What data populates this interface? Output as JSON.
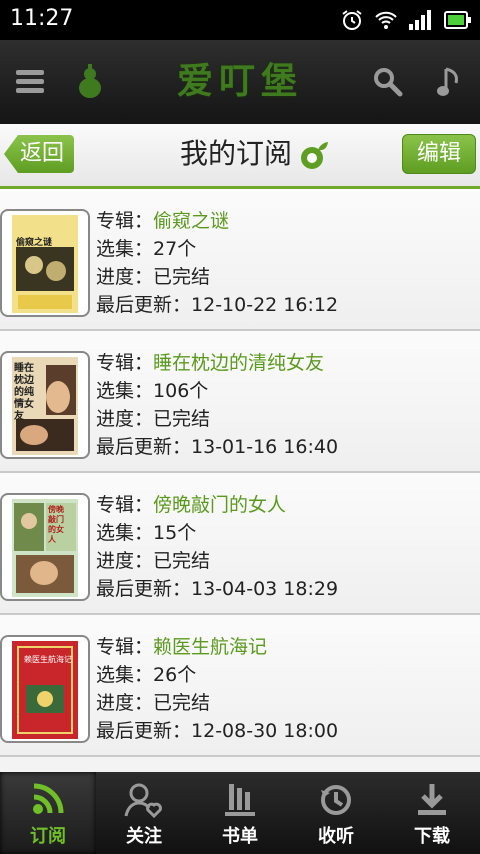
{
  "status_bar": {
    "time": "11:27"
  },
  "app_bar": {
    "logo_text": "爱叮堡"
  },
  "title_bar": {
    "back_label": "返回",
    "title": "我的订阅",
    "edit_label": "编辑"
  },
  "labels": {
    "album": "专辑：",
    "episodes": "选集：",
    "progress": "进度：",
    "updated": "最后更新："
  },
  "subscriptions": [
    {
      "album": "偷窥之谜",
      "episodes": "27个",
      "progress": "已完结",
      "updated": "12-10-22 16:12",
      "cover_text": "偷窥之谜"
    },
    {
      "album": "睡在枕边的清纯女友",
      "episodes": "106个",
      "progress": "已完结",
      "updated": "13-01-16 16:40",
      "cover_text": "睡在枕边的纯情女友"
    },
    {
      "album": "傍晚敲门的女人",
      "episodes": "15个",
      "progress": "已完结",
      "updated": "13-04-03 18:29",
      "cover_text": "傍晚敲门的女人"
    },
    {
      "album": "赖医生航海记",
      "episodes": "26个",
      "progress": "已完结",
      "updated": "12-08-30 18:00",
      "cover_text": "赖医生航海记"
    }
  ],
  "bottom_nav": [
    {
      "label": "订阅",
      "icon": "rss-icon",
      "active": true
    },
    {
      "label": "关注",
      "icon": "follow-icon",
      "active": false
    },
    {
      "label": "书单",
      "icon": "booklist-icon",
      "active": false
    },
    {
      "label": "收听",
      "icon": "history-icon",
      "active": false
    },
    {
      "label": "下载",
      "icon": "download-icon",
      "active": false
    }
  ],
  "colors": {
    "accent": "#6faa2d",
    "album_text": "#5b9a1e",
    "nav_active": "#6fbf28"
  }
}
